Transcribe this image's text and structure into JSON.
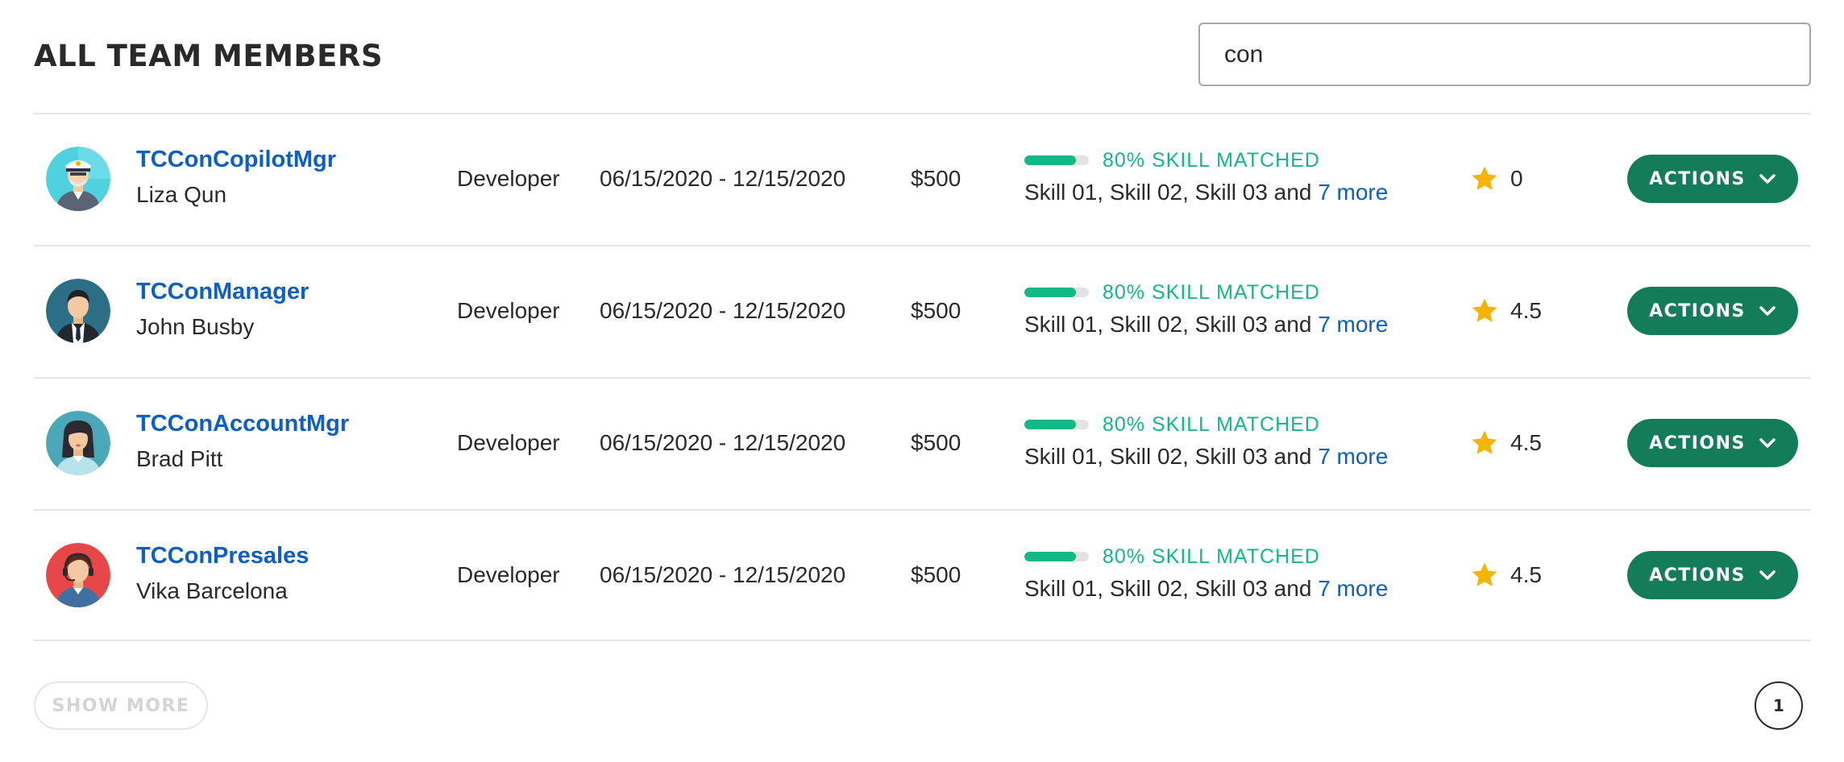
{
  "header": {
    "title": "ALL TEAM MEMBERS",
    "search_value": "con"
  },
  "members": [
    {
      "handle": "TCConCopilotMgr",
      "name": "Liza Qun",
      "role": "Developer",
      "dates": "06/15/2020 - 12/15/2020",
      "rate": "$500",
      "skill_match_label": "80% SKILL MATCHED",
      "skill_match_fraction": 0.8,
      "skills_text": "Skill 01, Skill 02, Skill 03 and ",
      "more_link": "7 more",
      "rating": "0",
      "actions_label": "ACTIONS",
      "avatar_icon": "captain-avatar-icon",
      "avatar_bg": "#4fd1e0"
    },
    {
      "handle": "TCConManager",
      "name": "John Busby",
      "role": "Developer",
      "dates": "06/15/2020 - 12/15/2020",
      "rate": "$500",
      "skill_match_label": "80% SKILL MATCHED",
      "skill_match_fraction": 0.8,
      "skills_text": "Skill 01, Skill 02, Skill 03 and ",
      "more_link": "7 more",
      "rating": "4.5",
      "actions_label": "ACTIONS",
      "avatar_icon": "businessman-avatar-icon",
      "avatar_bg": "#2c6e86"
    },
    {
      "handle": "TCConAccountMgr",
      "name": "Brad Pitt",
      "role": "Developer",
      "dates": "06/15/2020 - 12/15/2020",
      "rate": "$500",
      "skill_match_label": "80% SKILL MATCHED",
      "skill_match_fraction": 0.8,
      "skills_text": "Skill 01, Skill 02, Skill 03 and ",
      "more_link": "7 more",
      "rating": "4.5",
      "actions_label": "ACTIONS",
      "avatar_icon": "woman-avatar-icon",
      "avatar_bg": "#4aa8b8"
    },
    {
      "handle": "TCConPresales",
      "name": "Vika Barcelona",
      "role": "Developer",
      "dates": "06/15/2020 - 12/15/2020",
      "rate": "$500",
      "skill_match_label": "80% SKILL MATCHED",
      "skill_match_fraction": 0.8,
      "skills_text": "Skill 01, Skill 02, Skill 03 and ",
      "more_link": "7 more",
      "rating": "4.5",
      "actions_label": "ACTIONS",
      "avatar_icon": "support-agent-avatar-icon",
      "avatar_bg": "#e8474a"
    }
  ],
  "footer": {
    "show_more_label": "SHOW MORE",
    "current_page": "1"
  },
  "colors": {
    "link": "#0b5fc7",
    "accent_green": "#12b886",
    "button_green": "#137d5a",
    "star": "#f5b400"
  }
}
